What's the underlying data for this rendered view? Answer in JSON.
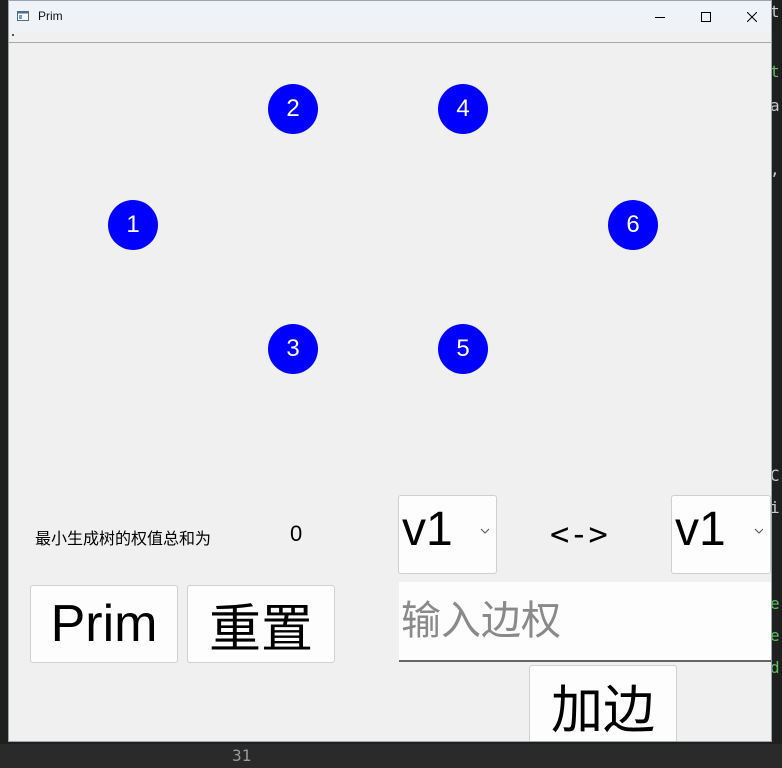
{
  "window": {
    "title": "Prim"
  },
  "graph": {
    "nodes": [
      {
        "label": "1"
      },
      {
        "label": "2"
      },
      {
        "label": "3"
      },
      {
        "label": "4"
      },
      {
        "label": "5"
      },
      {
        "label": "6"
      }
    ],
    "node_color": "#0000ff"
  },
  "controls": {
    "mst_label": "最小生成树的权值总和为",
    "mst_sum": "0",
    "from_vertex": "v1",
    "to_vertex": "v1",
    "arrow": "<->",
    "weight_placeholder": "输入边权",
    "weight_value": "",
    "prim_button": "Prim",
    "reset_button": "重置",
    "add_edge_button": "加边"
  },
  "background": {
    "line_number": "31"
  }
}
